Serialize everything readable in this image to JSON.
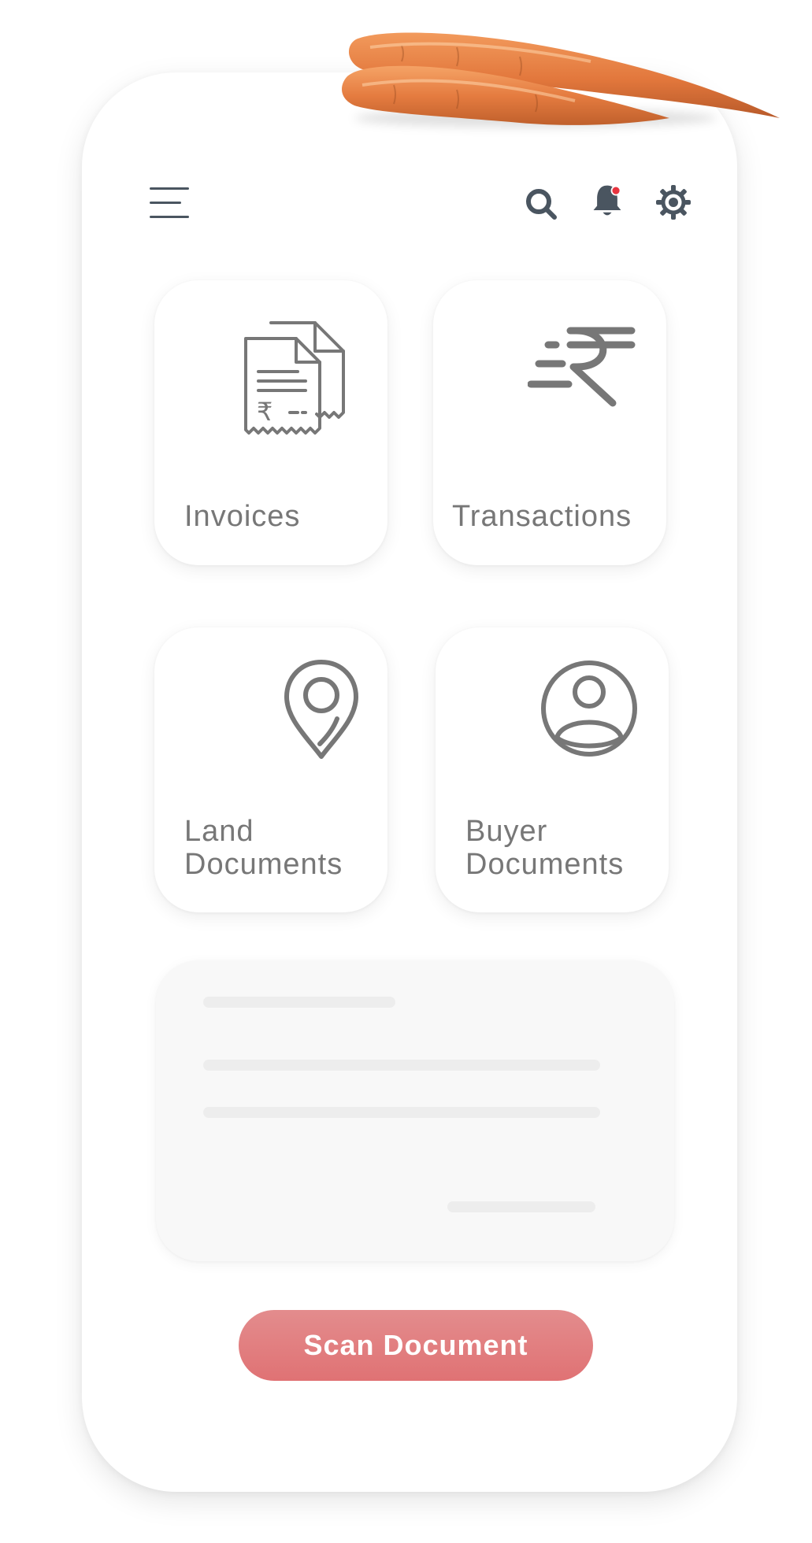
{
  "tiles": [
    {
      "id": "invoices",
      "label_lines": [
        "Invoices"
      ],
      "icon": "receipt-rupee-icon"
    },
    {
      "id": "transactions",
      "label_lines": [
        "Transactions"
      ],
      "icon": "rupee-transactions-icon"
    },
    {
      "id": "land-documents",
      "label_lines": [
        "Land",
        "Documents"
      ],
      "icon": "map-pin-icon"
    },
    {
      "id": "buyer-documents",
      "label_lines": [
        "Buyer",
        "Documents"
      ],
      "icon": "user-circle-icon"
    }
  ],
  "header": {
    "menu_icon": "hamburger-menu-icon",
    "search_icon": "search-icon",
    "notification_icon": "bell-icon",
    "settings_icon": "gear-icon",
    "notification_dot_color": "#e8343f"
  },
  "scan_button": {
    "label": "Scan Document",
    "color": "#e07b7d"
  },
  "colors": {
    "icon": "#777777",
    "header_icon": "#4a5560",
    "label": "#777777"
  }
}
